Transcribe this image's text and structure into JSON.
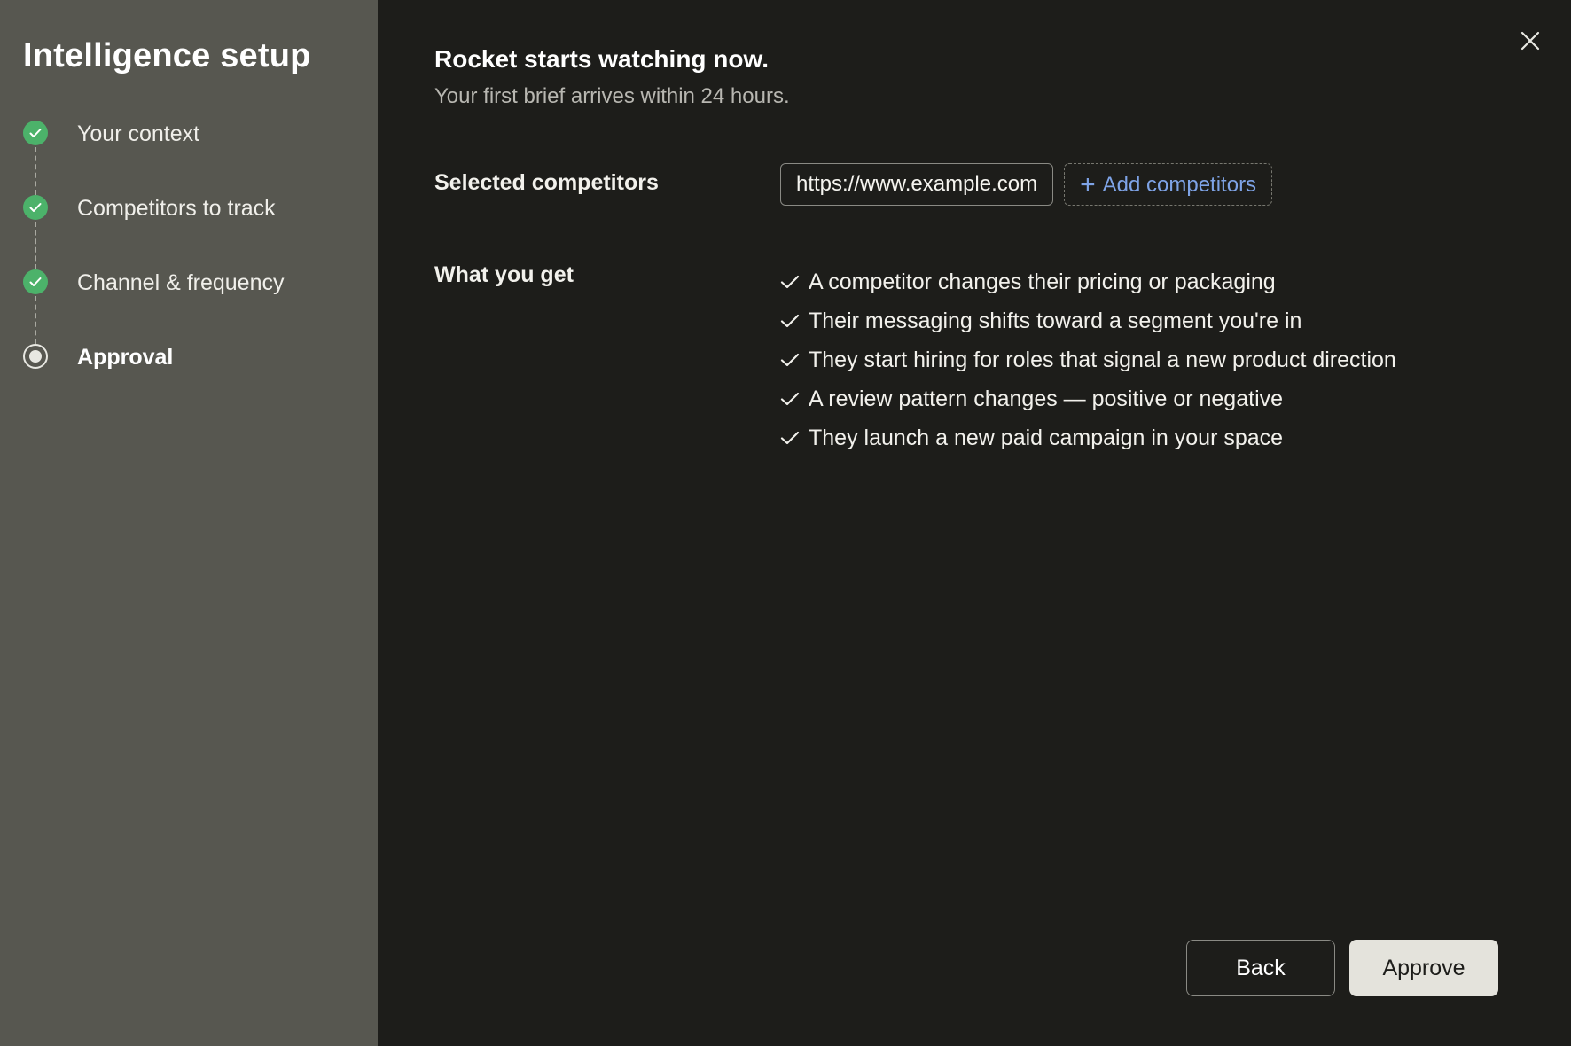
{
  "sidebar": {
    "title": "Intelligence setup",
    "steps": [
      {
        "label": "Your context",
        "status": "done"
      },
      {
        "label": "Competitors to track",
        "status": "done"
      },
      {
        "label": "Channel & frequency",
        "status": "done"
      },
      {
        "label": "Approval",
        "status": "current"
      }
    ]
  },
  "main": {
    "title": "Rocket starts watching now.",
    "subtitle": "Your first brief arrives within 24 hours.",
    "competitors": {
      "label": "Selected competitors",
      "items": [
        "https://www.example.com"
      ],
      "add_label": "Add competitors"
    },
    "benefits": {
      "label": "What you get",
      "items": [
        "A competitor changes their pricing or packaging",
        "Their messaging shifts toward a segment you're in",
        "They start hiring for roles that signal a new product direction",
        "A review pattern changes — positive or negative",
        "They launch a new paid campaign in your space"
      ]
    },
    "footer": {
      "back_label": "Back",
      "approve_label": "Approve"
    }
  },
  "colors": {
    "sidebar_bg": "#575750",
    "main_bg": "#1d1d1a",
    "step_done": "#4cb26a",
    "link": "#7ea3e6",
    "approve_bg": "#e4e3dc"
  },
  "icons": {
    "close": "close-icon",
    "step_done": "check-icon",
    "benefit": "check-icon",
    "add": "plus-icon"
  }
}
